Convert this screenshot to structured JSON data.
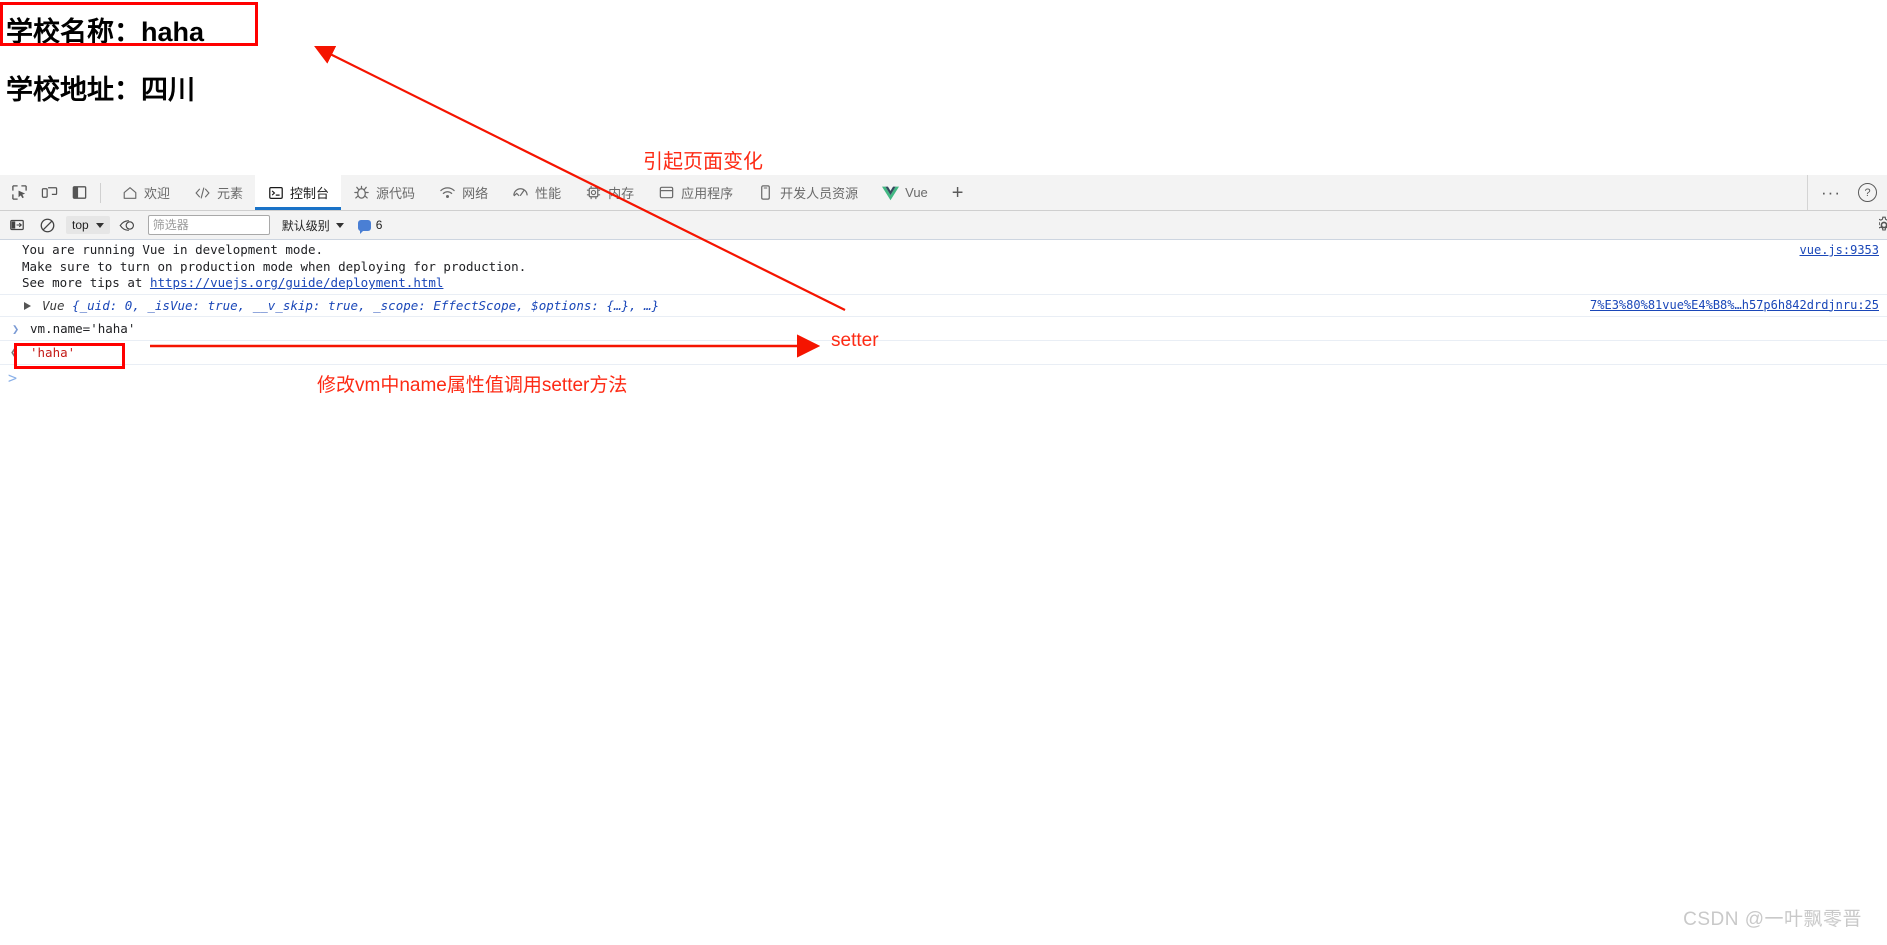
{
  "page": {
    "line1": "学校名称：haha",
    "line2": "学校地址：四川"
  },
  "devtools": {
    "dock_icons": [
      {
        "name": "inspect-element-icon",
        "label": "检查元素"
      },
      {
        "name": "device-toolbar-icon",
        "label": "设备工具栏"
      },
      {
        "name": "dock-side-icon",
        "label": "停靠位置"
      }
    ],
    "tabs": [
      {
        "label": "欢迎",
        "icon": "home-icon",
        "active": false
      },
      {
        "label": "元素",
        "icon": "code-brackets-icon",
        "active": false
      },
      {
        "label": "控制台",
        "icon": "console-prompt-icon",
        "active": true
      },
      {
        "label": "源代码",
        "icon": "bug-icon",
        "active": false
      },
      {
        "label": "网络",
        "icon": "wifi-icon",
        "active": false
      },
      {
        "label": "性能",
        "icon": "gauge-icon",
        "active": false
      },
      {
        "label": "内存",
        "icon": "chip-icon",
        "active": false
      },
      {
        "label": "应用程序",
        "icon": "box-icon",
        "active": false
      },
      {
        "label": "开发人员资源",
        "icon": "mobile-icon",
        "active": false
      },
      {
        "label": "Vue",
        "icon": "vue-logo-icon",
        "active": false
      }
    ],
    "add_tab_label": "+",
    "more_tools_label": "···",
    "help_label": "?"
  },
  "filterbar": {
    "sidebar_toggle": "console-sidebar-icon",
    "clear_label": "clear-console-icon",
    "context": "top",
    "live_expression": "eye-icon",
    "filter_placeholder": "筛选器",
    "filter_value": "",
    "level": "默认级别",
    "message_count": "6",
    "settings_label": "settings-gear-icon"
  },
  "console": {
    "warning": {
      "line1": "You are running Vue in development mode.",
      "line2": "Make sure to turn on production mode when deploying for production.",
      "line3_prefix": "See more tips at ",
      "line3_link": "https://vuejs.org/guide/deployment.html",
      "source": "vue.js:9353"
    },
    "object": {
      "type": "Vue",
      "body": "{_uid: 0, _isVue: true, __v_skip: true, _scope: EffectScope, $options: {…}, …}",
      "source": "7%E3%80%81vue%E4%B8%…h57p6h842drdjnru:25"
    },
    "input": "vm.name='haha'",
    "output": "'haha'",
    "prompt": ">"
  },
  "annotations": {
    "page_change": "引起页面变化",
    "setter": "setter",
    "modify_setter": "修改vm中name属性值调用setter方法"
  },
  "watermark": "CSDN @一叶飘零晋",
  "colors": {
    "annotation_red": "#fd2a14",
    "active_tab_underline": "#1a73c8",
    "link_blue": "#1a47b8",
    "vue_green": "#42b883"
  }
}
